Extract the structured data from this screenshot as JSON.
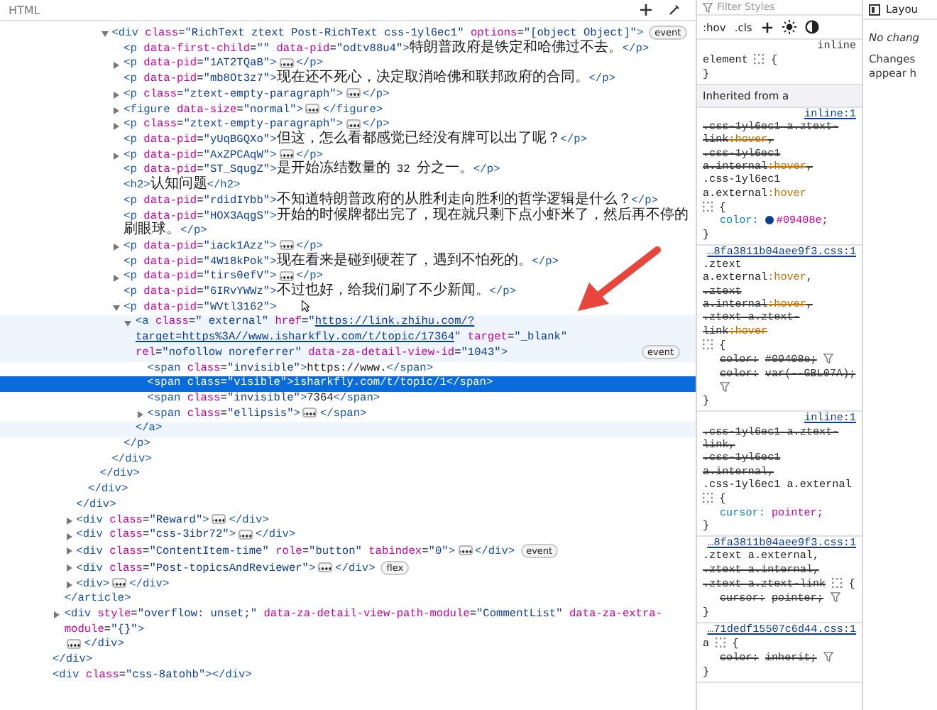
{
  "inspector": {
    "title": "HTML"
  },
  "tree": [
    {
      "close": "</div>",
      "children": [
        {
          "close": "</article>",
          "children": [
            {
              "close": "</div>",
              "children": [
                {
                  "close": "</div>",
                  "children": [
                    {
                      "close": "</div>",
                      "children": [
                        {
                          "head": "<div class=\"RichText ztext Post-RichText css-1yl6ec1\" options=\"[object Object]\">",
                          "badge": "event",
                          "expanded": true,
                          "selected": false,
                          "close": "</div>",
                          "children": [
                            {
                              "head": "<p data-first-child=\"\" data-pid=\"odtv88u4\">特朗普政府是铁定和哈佛过不去。</p>",
                              "selected": false
                            },
                            {
                              "head": "<p data-pid=\"1AT2TQaB\">",
                              "expanded": false,
                              "tail": "</p>",
                              "selected": false
                            },
                            {
                              "head": "<p data-pid=\"mb8Ot3z7\">现在还不死心，决定取消哈佛和联邦政府的合同。</p>",
                              "selected": false
                            },
                            {
                              "head": "<p class=\"ztext-empty-paragraph\">",
                              "expanded": false,
                              "tail": "</p>",
                              "selected": false
                            },
                            {
                              "head": "<figure data-size=\"normal\">",
                              "expanded": false,
                              "tail": "</figure>",
                              "selected": false
                            },
                            {
                              "head": "<p class=\"ztext-empty-paragraph\">",
                              "expanded": false,
                              "tail": "</p>",
                              "selected": false
                            },
                            {
                              "head": "<p data-pid=\"yUqBGQXo\">但这，怎么看都感觉已经没有牌可以出了呢？</p>",
                              "selected": false
                            },
                            {
                              "head": "<p data-pid=\"AxZPCAqW\">",
                              "expanded": false,
                              "tail": "</p>",
                              "selected": false
                            },
                            {
                              "head": "<p data-pid=\"ST_SqugZ\">是开始冻结数量的 32 分之一。</p>",
                              "selected": false
                            },
                            {
                              "head": "<h2>认知问题</h2>",
                              "selected": false
                            },
                            {
                              "head": "<p data-pid=\"rdidIYbb\">不知道特朗普政府的从胜利走向胜利的哲学逻辑是什么？</p>",
                              "selected": false
                            },
                            {
                              "head": "<p data-pid=\"HOX3AqgS\">开始的时候牌都出完了，现在就只剩下点小虾米了，然后再不停的刷眼球。</p>",
                              "selected": false
                            },
                            {
                              "head": "<p data-pid=\"iack1Azz\">",
                              "expanded": false,
                              "tail": "</p>",
                              "selected": false
                            },
                            {
                              "head": "<p data-pid=\"4W18kPok\">现在看来是碰到硬茬了，遇到不怕死的。</p>",
                              "selected": false
                            },
                            {
                              "head": "<p data-pid=\"tirs0efV\">",
                              "expanded": false,
                              "tail": "</p>",
                              "selected": false
                            },
                            {
                              "head": "<p data-pid=\"6IRvYWWz\">不过也好，给我们刷了不少新闻。</p>",
                              "selected": false
                            },
                            {
                              "head": "<p data-pid=\"WVtl3162\">",
                              "expanded": true,
                              "selected": false,
                              "close": "</p>",
                              "children": [
                                {
                                  "head": "<a class=\" external\" href=\"",
                                  "link": "https://link.zhihu.com/?target=https%3A//www.isharkfly.com/t/topic/17364",
                                  "head_end": [
                                    "\" target=\"_blank\" rel=\"nofollow noreferrer\"",
                                    "data-za-detail-view-id=\"1043\">"
                                  ],
                                  "badge": "event",
                                  "expanded": true,
                                  "hovered": true,
                                  "selected": false,
                                  "close": "</a>",
                                  "children": [
                                    {
                                      "head": "<span class=\"invisible\">https://www.</span>",
                                      "selected": false
                                    },
                                    {
                                      "head": "<span class=\"visible\">isharkfly.com/t/topic/1</span>",
                                      "selected": true
                                    },
                                    {
                                      "head": "<span class=\"invisible\">7364</span>",
                                      "selected": false
                                    },
                                    {
                                      "head": "<span class=\"ellipsis\">",
                                      "expanded": false,
                                      "tail": "</span>",
                                      "selected": false
                                    }
                                  ]
                                }
                              ]
                            }
                          ]
                        }
                      ]
                    }
                  ]
                }
              ]
            },
            {
              "head": "<div class=\"Reward\">",
              "expanded": false,
              "tail": "</div>",
              "selected": false
            },
            {
              "head": "<div class=\"css-3ibr72\">",
              "expanded": false,
              "tail": "</div>",
              "selected": false
            },
            {
              "head": "<div class=\"ContentItem-time\" role=\"button\" tabindex=\"0\">",
              "expanded": false,
              "tail": "</div>",
              "badge": "event",
              "selected": false
            },
            {
              "head": "<div class=\"Post-topicsAndReviewer\">",
              "expanded": false,
              "tail": "</div>",
              "badge": "flex",
              "selected": false
            },
            {
              "head": "<div>",
              "expanded": false,
              "tail": "</div>",
              "selected": false
            }
          ]
        },
        {
          "head": "<div style=\"overflow: unset;\" data-za-detail-view-path-module=\"CommentList\" data-za-extra-module=\"{}\">",
          "expanded": false,
          "tail": "</div>",
          "selected": false
        }
      ]
    },
    {
      "head": "<div class=\"css-8atohb\"></div>",
      "selected": false
    }
  ],
  "styles": {
    "filter": {
      "placeholder": "Filter Styles"
    },
    "toolbar": [
      ":hov",
      ".cls"
    ],
    "rules": [
      {
        "kind": "rule",
        "source": "inline",
        "source_link": false,
        "selectors": [
          {
            "text": "element",
            "overridden": false
          }
        ],
        "open": "{",
        "close": "}"
      },
      {
        "kind": "header",
        "label": "Inherited from a"
      },
      {
        "kind": "rule",
        "source": "inline:1",
        "source_link": true,
        "selectors": [
          {
            "text": ".css-1yl6ec1 a.ztext-link:hover,",
            "overridden": true
          },
          {
            "text": ".css-1yl6ec1 a.internal:hover,",
            "overridden": true
          },
          {
            "text": ".css-1yl6ec1 a.external:hover",
            "overridden": false
          }
        ],
        "open": "{",
        "close": "}",
        "declarations": [
          {
            "property": "color:",
            "value": "#09408e;",
            "overridden": false,
            "color": "#09408e"
          }
        ]
      },
      {
        "kind": "rule",
        "source": "…8fa3811b04aee9f3.css:1",
        "source_link": true,
        "selectors": [
          {
            "text": ".ztext a.external:hover,",
            "overridden": false
          },
          {
            "text": ".ztext a.internal:hover,",
            "overridden": true
          },
          {
            "text": ".ztext a.ztext-link:hover",
            "overridden": true
          }
        ],
        "open": "{",
        "close": "}",
        "declarations": [
          {
            "property": "color:",
            "value": "#09408e;",
            "overridden": true
          },
          {
            "property": "color:",
            "value": "var(--GBL07A);",
            "overridden": true
          }
        ]
      },
      {
        "kind": "rule",
        "source": "inline:1",
        "source_link": true,
        "selectors": [
          {
            "text": ".css-1yl6ec1 a.ztext-link,",
            "overridden": true
          },
          {
            "text": ".css-1yl6ec1 a.internal,",
            "overridden": true
          },
          {
            "text": ".css-1yl6ec1 a.external",
            "overridden": false
          }
        ],
        "open": "{",
        "close": "}",
        "declarations": [
          {
            "property": "cursor:",
            "value": "pointer;",
            "overridden": false
          }
        ]
      },
      {
        "kind": "rule",
        "source": "…8fa3811b04aee9f3.css:1",
        "source_link": true,
        "selectors": [
          {
            "text": ".ztext a.external,",
            "overridden": false
          },
          {
            "text": ".ztext a.internal,",
            "overridden": true
          },
          {
            "text": ".ztext a.ztext-link",
            "overridden": true
          }
        ],
        "open": "{",
        "close": "}",
        "declarations": [
          {
            "property": "cursor:",
            "value": "pointer;",
            "overridden": true
          }
        ]
      },
      {
        "kind": "rule",
        "source": "…71dedf15507c6d44.css:1",
        "source_link": true,
        "selectors": [
          {
            "text": "a",
            "overridden": false
          }
        ],
        "open": "{",
        "close": "}",
        "declarations": [
          {
            "property": "color:",
            "value": "inherit;",
            "overridden": true
          }
        ]
      }
    ]
  },
  "side_panel": {
    "tab": "Layou",
    "message": "No chang",
    "hint": [
      "Changes",
      "appear h"
    ]
  }
}
